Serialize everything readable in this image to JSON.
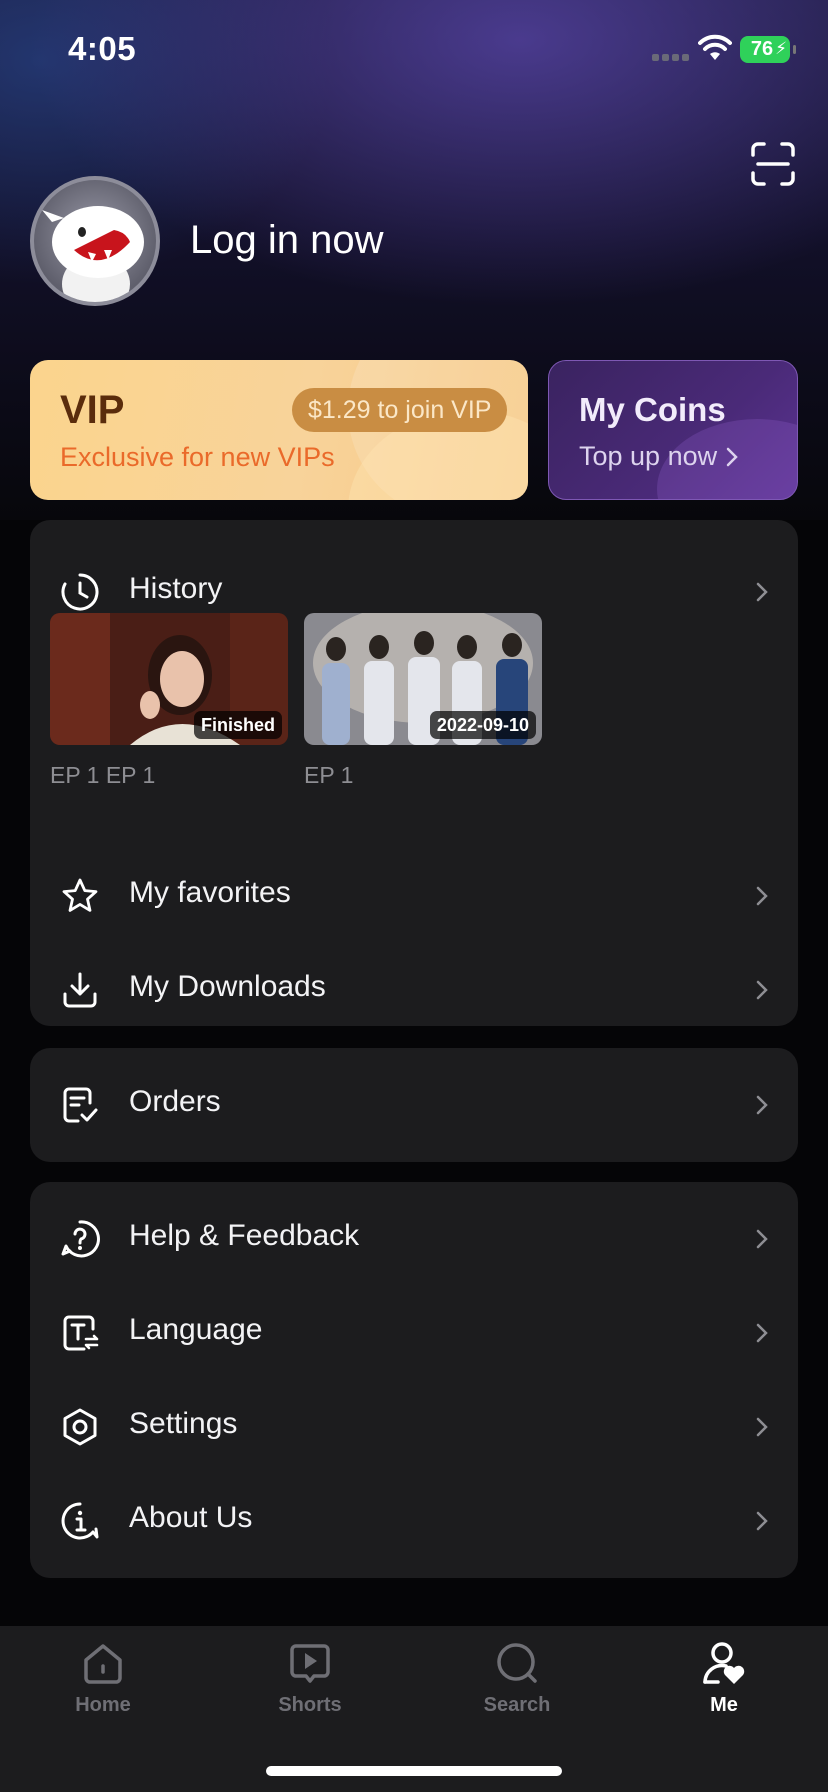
{
  "status_bar": {
    "time": "4:05",
    "battery": "76"
  },
  "profile": {
    "login_text": "Log in now"
  },
  "vip": {
    "title": "VIP",
    "subtitle": "Exclusive for new VIPs",
    "join_button": "$1.29 to join VIP"
  },
  "coins": {
    "title": "My Coins",
    "subtitle": "Top up now"
  },
  "history": {
    "label": "History",
    "items": [
      {
        "badge": "Finished",
        "episode": "EP 1 EP 1"
      },
      {
        "badge": "2022-09-10",
        "episode": "EP 1"
      }
    ]
  },
  "library": {
    "favorites": "My favorites",
    "downloads": "My Downloads"
  },
  "orders": {
    "label": "Orders"
  },
  "more": {
    "help": "Help & Feedback",
    "language": "Language",
    "settings": "Settings",
    "about": "About Us"
  },
  "tabbar": {
    "home": "Home",
    "shorts": "Shorts",
    "search": "Search",
    "me": "Me",
    "active": "me"
  },
  "colors": {
    "vip_accent": "#ea6a2a",
    "vip_title": "#5a2c0c",
    "coins_bg": "#4a2a78",
    "card_bg": "#1c1c1e",
    "battery": "#2fd15a"
  }
}
